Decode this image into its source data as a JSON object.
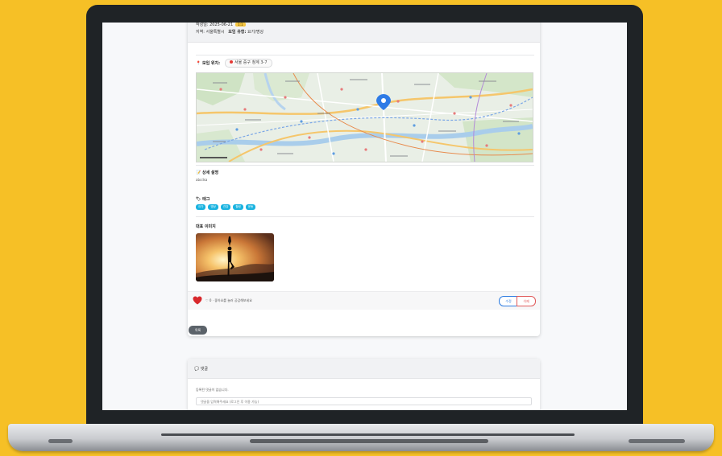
{
  "post": {
    "date_prefix": "작성일: 2025-06-21",
    "date_badge": "1:1",
    "location_line": "지역: 서울특별시",
    "category_label": "모임 유형:",
    "category_value": "요가/명상"
  },
  "location": {
    "label": "📍 모임 위치:",
    "address": "서울 중구 청계 3-7"
  },
  "description": {
    "label": "📝 상세 설명",
    "text": "abcdsa"
  },
  "tags": {
    "label": "🏷 태그",
    "items": [
      "요가",
      "명상",
      "건강",
      "힐링",
      "운동"
    ]
  },
  "image": {
    "label": "대표 이미지"
  },
  "footer": {
    "like_text": "♡ 0 · 좋아요를 눌러 공감해보세요",
    "edit_label": "수정",
    "delete_label": "삭제"
  },
  "list_button": "목록",
  "comments": {
    "title": "💬 댓글",
    "empty_text": "등록된 댓글이 없습니다.",
    "input_placeholder": "댓글을 입력해주세요 (로그인 후 이용 가능)"
  },
  "colors": {
    "accent": "#1ab3e0",
    "edit": "#2f7de1",
    "delete": "#e05a5a",
    "badge": "#f4c542",
    "background": "#f6c026"
  }
}
